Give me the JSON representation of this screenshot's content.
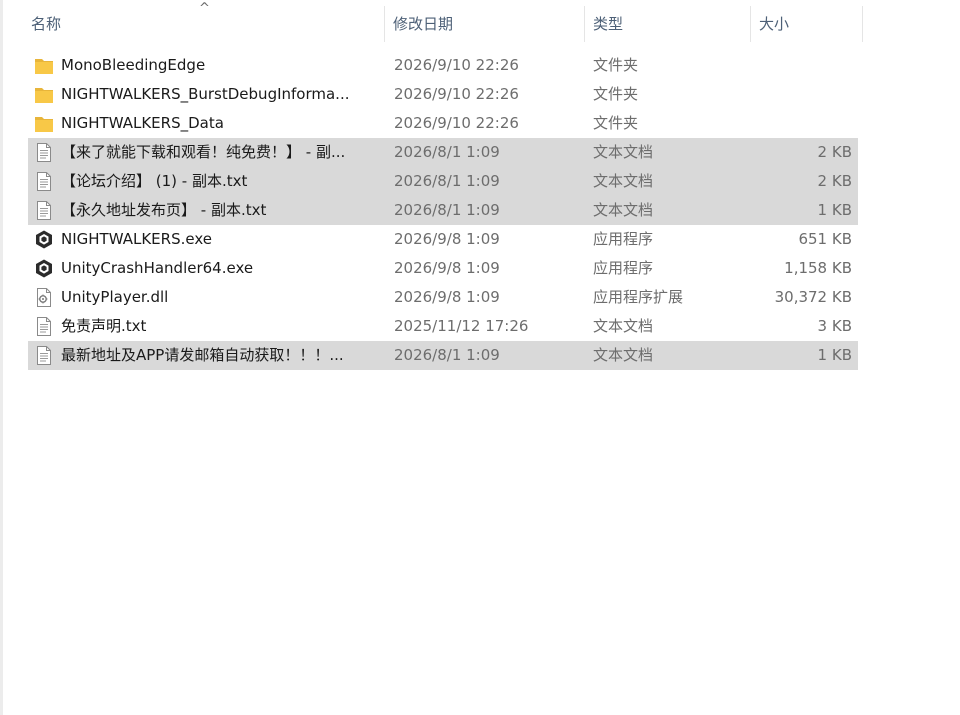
{
  "columns": {
    "name": "名称",
    "date": "修改日期",
    "type": "类型",
    "size": "大小"
  },
  "sort": {
    "column": "name",
    "indicator": "^"
  },
  "colors": {
    "selected_row": "#d9d9d9",
    "folder": "#f8c847",
    "header_text": "#4d6077",
    "secondary_text": "#6d6d6d"
  },
  "files": [
    {
      "name": "MonoBleedingEdge",
      "date": "2026/9/10 22:26",
      "type": "文件夹",
      "size": "",
      "icon": "folder-icon",
      "selected": false
    },
    {
      "name": "NIGHTWALKERS_BurstDebugInforma...",
      "date": "2026/9/10 22:26",
      "type": "文件夹",
      "size": "",
      "icon": "folder-icon",
      "selected": false
    },
    {
      "name": "NIGHTWALKERS_Data",
      "date": "2026/9/10 22:26",
      "type": "文件夹",
      "size": "",
      "icon": "folder-icon",
      "selected": false
    },
    {
      "name": "【来了就能下载和观看！纯免费！】 - 副...",
      "date": "2026/8/1 1:09",
      "type": "文本文档",
      "size": "2 KB",
      "icon": "text-file-icon",
      "selected": true
    },
    {
      "name": "【论坛介绍】 (1) - 副本.txt",
      "date": "2026/8/1 1:09",
      "type": "文本文档",
      "size": "2 KB",
      "icon": "text-file-icon",
      "selected": true
    },
    {
      "name": "【永久地址发布页】 - 副本.txt",
      "date": "2026/8/1 1:09",
      "type": "文本文档",
      "size": "1 KB",
      "icon": "text-file-icon",
      "selected": true
    },
    {
      "name": "NIGHTWALKERS.exe",
      "date": "2026/9/8 1:09",
      "type": "应用程序",
      "size": "651 KB",
      "icon": "unity-app-icon",
      "selected": false
    },
    {
      "name": "UnityCrashHandler64.exe",
      "date": "2026/9/8 1:09",
      "type": "应用程序",
      "size": "1,158 KB",
      "icon": "unity-app-icon",
      "selected": false
    },
    {
      "name": "UnityPlayer.dll",
      "date": "2026/9/8 1:09",
      "type": "应用程序扩展",
      "size": "30,372 KB",
      "icon": "dll-file-icon",
      "selected": false
    },
    {
      "name": "免责声明.txt",
      "date": "2025/11/12 17:26",
      "type": "文本文档",
      "size": "3 KB",
      "icon": "text-file-icon",
      "selected": false
    },
    {
      "name": "最新地址及APP请发邮箱自动获取！！！...",
      "date": "2026/8/1 1:09",
      "type": "文本文档",
      "size": "1 KB",
      "icon": "text-file-icon",
      "selected": true
    }
  ]
}
